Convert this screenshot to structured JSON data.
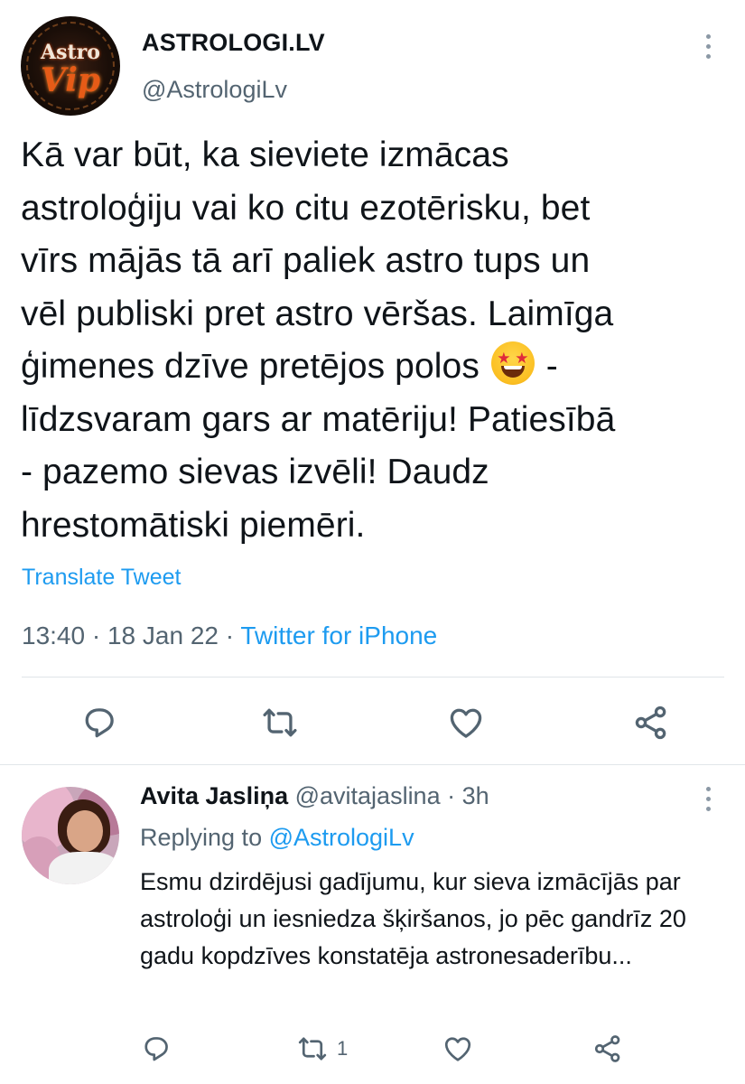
{
  "main_tweet": {
    "author_name": "ASTROLOGI.LV",
    "handle": "@AstrologiLv",
    "avatar_text_top": "Astro",
    "avatar_text_bottom": "Vip",
    "text_before_emoji": "Kā var būt, ka sieviete izmācas\nastroloģiju vai ko citu ezotērisku, bet\nvīrs mājās tā arī paliek astro tups un\nvēl publiski pret astro vēršas. Laimīga\nģimenes dzīve pretējos polos ",
    "emoji_name": "star-struck-emoji",
    "text_after_emoji": " -\nlīdzsvaram gars ar matēriju! Patiesībā\n- pazemo sievas izvēli! Daudz\nhrestomātiski piemēri.",
    "translate_label": "Translate Tweet",
    "time": "13:40",
    "date": "18 Jan 22",
    "separator": " · ",
    "source": "Twitter for iPhone"
  },
  "reply": {
    "author_name": "Avita Jasliņa",
    "handle": "@avitajaslina",
    "time_ago": "3h",
    "separator": " · ",
    "replying_prefix": "Replying to ",
    "replying_to": "@AstrologiLv",
    "text": "Esmu dzirdējusi gadījumu, kur sieva izmācījās par astroloģi un iesniedza šķiršanos, jo pēc gandrīz 20 gadu kopdzīves konstatēja astronesaderību...",
    "retweet_count": "1"
  },
  "colors": {
    "text_primary": "#0f1419",
    "text_secondary": "#536471",
    "link": "#1d9bf0",
    "divider": "#dfe4e8",
    "icon": "#536471"
  },
  "icons": [
    "more-vertical-icon",
    "reply-icon",
    "retweet-icon",
    "like-icon",
    "share-icon"
  ]
}
